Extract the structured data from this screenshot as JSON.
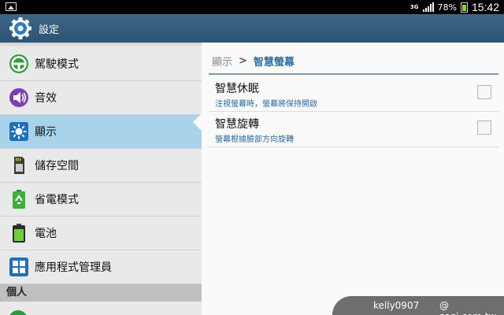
{
  "status_bar": {
    "network": "3G",
    "battery_percent": "78%",
    "battery_level": 0.78,
    "time": "15:42",
    "icons": [
      "picture-notification-icon",
      "signal-icon",
      "battery-icon"
    ]
  },
  "action_bar": {
    "title": "設定",
    "icon": "gear-icon"
  },
  "sidebar": {
    "items": [
      {
        "label": "駕駛模式",
        "icon": "steering-wheel-icon",
        "selected": false
      },
      {
        "label": "音效",
        "icon": "speaker-icon",
        "selected": false
      },
      {
        "label": "顯示",
        "icon": "display-brightness-icon",
        "selected": true
      },
      {
        "label": "儲存空間",
        "icon": "sd-card-icon",
        "selected": false
      },
      {
        "label": "省電模式",
        "icon": "recycle-battery-icon",
        "selected": false
      },
      {
        "label": "電池",
        "icon": "battery-icon",
        "selected": false
      },
      {
        "label": "應用程式管理員",
        "icon": "app-grid-icon",
        "selected": false
      }
    ],
    "section_header": "個人"
  },
  "content": {
    "breadcrumb": {
      "parent": "顯示",
      "separator": ">",
      "current": "智慧螢幕"
    },
    "preferences": [
      {
        "title": "智慧休眠",
        "summary": "注視螢幕時，螢幕將保持開啟",
        "checked": false
      },
      {
        "title": "智慧旋轉",
        "summary": "螢幕根據臉部方向旋轉",
        "checked": false
      }
    ]
  },
  "watermark": {
    "user": "kelly0907",
    "site": "@ sogi.com.tw"
  },
  "colors": {
    "action_bar": "#35597a",
    "selected_item": "#a9d3ea",
    "accent_text": "#2f6fa0"
  }
}
